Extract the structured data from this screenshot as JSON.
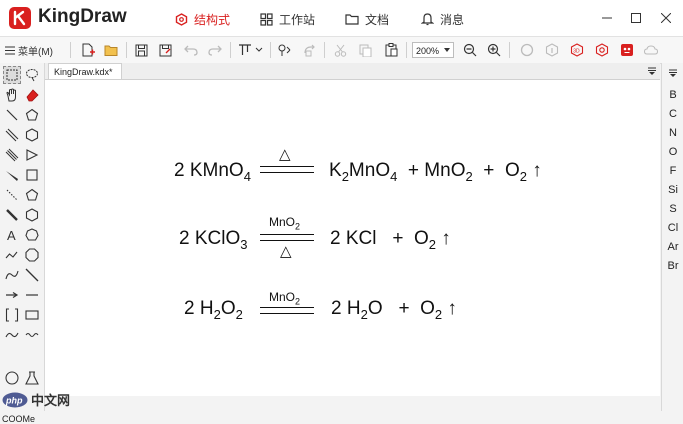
{
  "app": {
    "title": "KingDraw"
  },
  "nav": {
    "tabs": [
      {
        "label": "结构式",
        "active": true
      },
      {
        "label": "工作站",
        "active": false
      },
      {
        "label": "文档",
        "active": false
      },
      {
        "label": "消息",
        "active": false
      }
    ]
  },
  "window_controls": {
    "minimize": "minimize-icon",
    "maximize": "maximize-icon",
    "close": "close-icon"
  },
  "toolbar": {
    "menu_label": "菜单(M)",
    "zoom_value": "200%"
  },
  "document": {
    "tab_label": "KingDraw.kdx*"
  },
  "left_tools": {
    "coome_label": "COOMe"
  },
  "elements": [
    "B",
    "C",
    "N",
    "O",
    "F",
    "Si",
    "S",
    "Cl",
    "Ar",
    "Br"
  ],
  "equations": [
    {
      "reactant_coef": "2",
      "reactant": "KMnO",
      "reactant_sub": "4",
      "condition_top": "△",
      "condition_bottom": "",
      "p1": "K",
      "p1_sub1": "2",
      "p1_mid": "MnO",
      "p1_sub2": "4",
      "plus1": "+",
      "p2": "MnO",
      "p2_sub": "2",
      "plus2": "+",
      "p3": "O",
      "p3_sub": "2",
      "arrow": "↑"
    },
    {
      "reactant_coef": "2",
      "reactant": "KClO",
      "reactant_sub": "3",
      "condition_top": "MnO",
      "condition_top_sub": "2",
      "condition_bottom": "△",
      "p1": "2 KCl",
      "plus1": "+",
      "p2": "O",
      "p2_sub": "2",
      "arrow": "↑"
    },
    {
      "reactant_coef": "2",
      "reactant": "H",
      "reactant_sub1": "2",
      "reactant_mid": "O",
      "reactant_sub2": "2",
      "condition_top": "MnO",
      "condition_top_sub": "2",
      "p1": "2 H",
      "p1_sub": "2",
      "p1_mid": "O",
      "plus1": "+",
      "p2": "O",
      "p2_sub": "2",
      "arrow": "↑"
    }
  ],
  "watermark": {
    "text": "中文网",
    "logo": "php"
  },
  "colors": {
    "brand": "#d9201f",
    "canvas": "#ffffff",
    "chrome": "#f3f3f3"
  }
}
